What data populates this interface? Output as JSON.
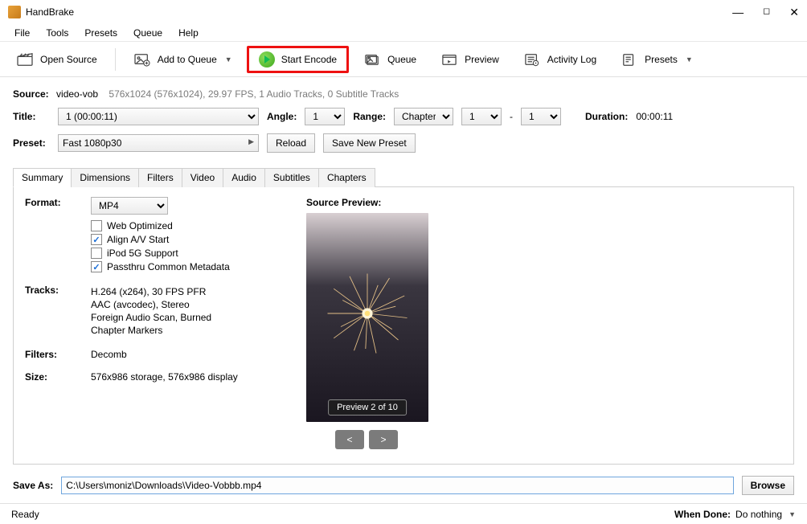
{
  "window": {
    "title": "HandBrake"
  },
  "menu": {
    "file": "File",
    "tools": "Tools",
    "presets": "Presets",
    "queue": "Queue",
    "help": "Help"
  },
  "toolbar": {
    "open_source": "Open Source",
    "add_to_queue": "Add to Queue",
    "start_encode": "Start Encode",
    "queue": "Queue",
    "preview": "Preview",
    "activity_log": "Activity Log",
    "presets": "Presets"
  },
  "source": {
    "label": "Source:",
    "name": "video-vob",
    "meta": "576x1024 (576x1024), 29.97 FPS, 1 Audio Tracks, 0 Subtitle Tracks"
  },
  "titleRow": {
    "title_label": "Title:",
    "title_value": "1  (00:00:11)",
    "angle_label": "Angle:",
    "angle_value": "1",
    "range_label": "Range:",
    "range_type": "Chapters",
    "range_from": "1",
    "range_sep": "-",
    "range_to": "1",
    "duration_label": "Duration:",
    "duration_value": "00:00:11"
  },
  "presetRow": {
    "label": "Preset:",
    "value": "Fast 1080p30",
    "reload": "Reload",
    "save_new": "Save New Preset"
  },
  "tabs": {
    "summary": "Summary",
    "dimensions": "Dimensions",
    "filters": "Filters",
    "video": "Video",
    "audio": "Audio",
    "subtitles": "Subtitles",
    "chapters": "Chapters"
  },
  "summary": {
    "format_label": "Format:",
    "format_value": "MP4",
    "web_optimized": "Web Optimized",
    "align_av": "Align A/V Start",
    "ipod": "iPod 5G Support",
    "passthru": "Passthru Common Metadata",
    "tracks_label": "Tracks:",
    "tracks": [
      "H.264 (x264), 30 FPS PFR",
      "AAC (avcodec), Stereo",
      "Foreign Audio Scan, Burned",
      "Chapter Markers"
    ],
    "filters_label": "Filters:",
    "filters_value": "Decomb",
    "size_label": "Size:",
    "size_value": "576x986 storage, 576x986 display"
  },
  "preview": {
    "heading": "Source Preview:",
    "badge": "Preview 2 of 10",
    "prev": "<",
    "next": ">"
  },
  "saveas": {
    "label": "Save As:",
    "path": "C:\\Users\\moniz\\Downloads\\Video-Vobbb.mp4",
    "browse": "Browse"
  },
  "status": {
    "left": "Ready",
    "when_done_label": "When Done:",
    "when_done_value": "Do nothing"
  }
}
